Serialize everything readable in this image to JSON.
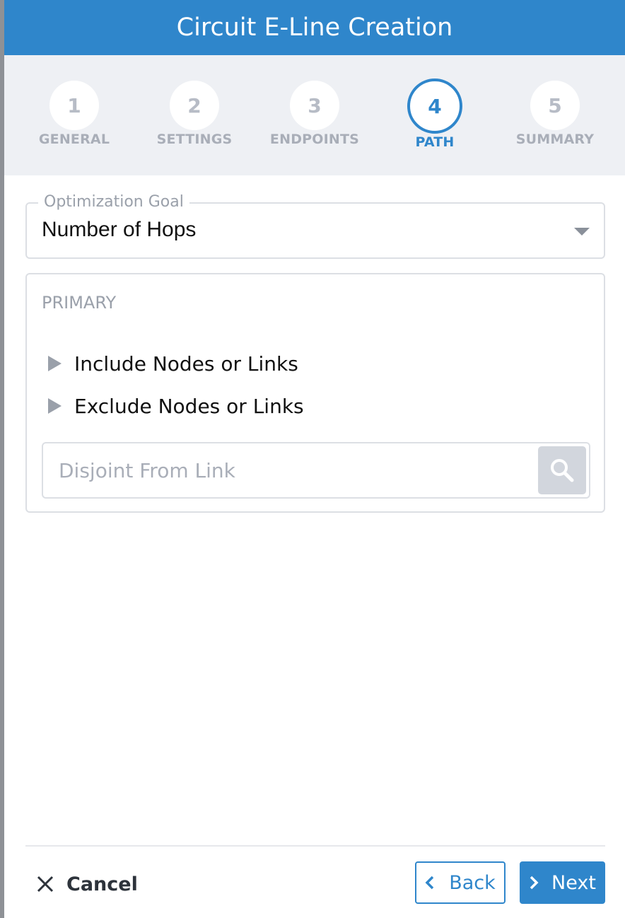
{
  "dialog": {
    "title": "Circuit E-Line Creation"
  },
  "stepper": {
    "active_step": 4,
    "steps": [
      {
        "number": "1",
        "label": "GENERAL"
      },
      {
        "number": "2",
        "label": "SETTINGS"
      },
      {
        "number": "3",
        "label": "ENDPOINTS"
      },
      {
        "number": "4",
        "label": "PATH"
      },
      {
        "number": "5",
        "label": "SUMMARY"
      }
    ]
  },
  "optimization": {
    "legend": "Optimization Goal",
    "value": "Number of Hops",
    "icon": "caret-down-icon"
  },
  "primary": {
    "title": "PRIMARY",
    "include_label": "Include Nodes or Links",
    "exclude_label": "Exclude Nodes or Links",
    "disjoint_placeholder": "Disjoint From Link",
    "search_icon": "search-icon"
  },
  "footer": {
    "cancel_label": "Cancel",
    "back_label": "Back",
    "next_label": "Next"
  },
  "colors": {
    "accent": "#2f86cb",
    "muted": "#a9aeb8",
    "border": "#dcdfe4",
    "stepper_bg": "#eef0f4"
  }
}
